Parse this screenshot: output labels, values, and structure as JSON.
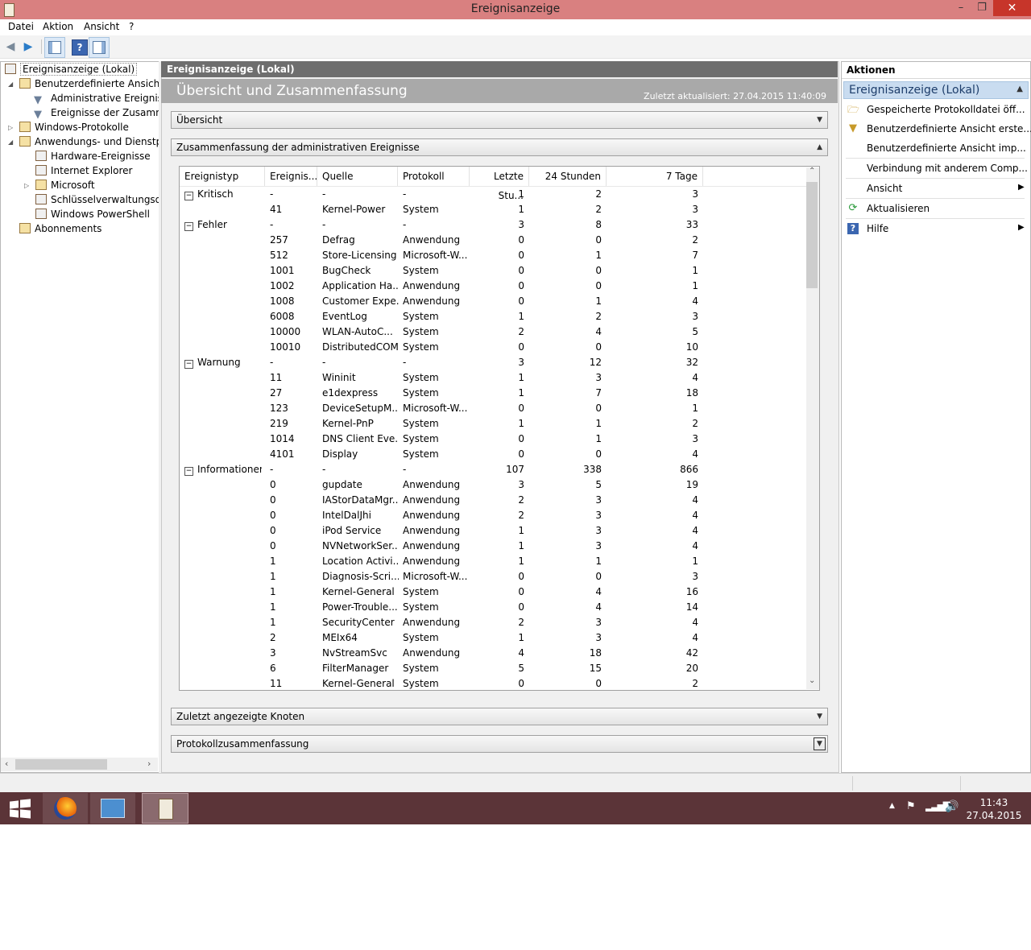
{
  "window": {
    "title": "Ereignisanzeige"
  },
  "menu": [
    "Datei",
    "Aktion",
    "Ansicht",
    "?"
  ],
  "tree": {
    "items": [
      {
        "label": "Ereignisanzeige (Lokal)"
      },
      {
        "label": "Benutzerdefinierte Ansichten"
      },
      {
        "label": "Administrative Ereignisse"
      },
      {
        "label": "Ereignisse der Zusammenfassung"
      },
      {
        "label": "Windows-Protokolle"
      },
      {
        "label": "Anwendungs- und Dienstprotokolle"
      },
      {
        "label": "Hardware-Ereignisse"
      },
      {
        "label": "Internet Explorer"
      },
      {
        "label": "Microsoft"
      },
      {
        "label": "Schlüsselverwaltungsdienst"
      },
      {
        "label": "Windows PowerShell"
      },
      {
        "label": "Abonnements"
      }
    ]
  },
  "center": {
    "header": "Ereignisanzeige (Lokal)",
    "title": "Übersicht und Zusammenfassung",
    "updated": "Zuletzt aktualisiert: 27.04.2015 11:40:09",
    "sections": {
      "overview": "Übersicht",
      "summary": "Zusammenfassung der administrativen Ereignisse",
      "recent": "Zuletzt angezeigte Knoten",
      "log": "Protokollzusammenfassung"
    },
    "columns": [
      "Ereignistyp",
      "Ereignis...",
      "Quelle",
      "Protokoll",
      "Letzte Stu...",
      "24 Stunden",
      "7 Tage"
    ],
    "rows": [
      [
        "Kritisch",
        "-",
        "-",
        "-",
        "1",
        "2",
        "3"
      ],
      [
        "",
        "41",
        "Kernel-Power",
        "System",
        "1",
        "2",
        "3"
      ],
      [
        "Fehler",
        "-",
        "-",
        "-",
        "3",
        "8",
        "33"
      ],
      [
        "",
        "257",
        "Defrag",
        "Anwendung",
        "0",
        "0",
        "2"
      ],
      [
        "",
        "512",
        "Store-Licensing",
        "Microsoft-W...",
        "0",
        "1",
        "7"
      ],
      [
        "",
        "1001",
        "BugCheck",
        "System",
        "0",
        "0",
        "1"
      ],
      [
        "",
        "1002",
        "Application Ha...",
        "Anwendung",
        "0",
        "0",
        "1"
      ],
      [
        "",
        "1008",
        "Customer Expe...",
        "Anwendung",
        "0",
        "1",
        "4"
      ],
      [
        "",
        "6008",
        "EventLog",
        "System",
        "1",
        "2",
        "3"
      ],
      [
        "",
        "10000",
        "WLAN-AutoC...",
        "System",
        "2",
        "4",
        "5"
      ],
      [
        "",
        "10010",
        "DistributedCOM",
        "System",
        "0",
        "0",
        "10"
      ],
      [
        "Warnung",
        "-",
        "-",
        "-",
        "3",
        "12",
        "32"
      ],
      [
        "",
        "11",
        "Wininit",
        "System",
        "1",
        "3",
        "4"
      ],
      [
        "",
        "27",
        "e1dexpress",
        "System",
        "1",
        "7",
        "18"
      ],
      [
        "",
        "123",
        "DeviceSetupM...",
        "Microsoft-W...",
        "0",
        "0",
        "1"
      ],
      [
        "",
        "219",
        "Kernel-PnP",
        "System",
        "1",
        "1",
        "2"
      ],
      [
        "",
        "1014",
        "DNS Client Eve...",
        "System",
        "0",
        "1",
        "3"
      ],
      [
        "",
        "4101",
        "Display",
        "System",
        "0",
        "0",
        "4"
      ],
      [
        "Informationen",
        "-",
        "-",
        "-",
        "107",
        "338",
        "866"
      ],
      [
        "",
        "0",
        "gupdate",
        "Anwendung",
        "3",
        "5",
        "19"
      ],
      [
        "",
        "0",
        "IAStorDataMgr...",
        "Anwendung",
        "2",
        "3",
        "4"
      ],
      [
        "",
        "0",
        "IntelDalJhi",
        "Anwendung",
        "2",
        "3",
        "4"
      ],
      [
        "",
        "0",
        "iPod Service",
        "Anwendung",
        "1",
        "3",
        "4"
      ],
      [
        "",
        "0",
        "NVNetworkSer...",
        "Anwendung",
        "1",
        "3",
        "4"
      ],
      [
        "",
        "1",
        "Location Activi...",
        "Anwendung",
        "1",
        "1",
        "1"
      ],
      [
        "",
        "1",
        "Diagnosis-Scri...",
        "Microsoft-W...",
        "0",
        "0",
        "3"
      ],
      [
        "",
        "1",
        "Kernel-General",
        "System",
        "0",
        "4",
        "16"
      ],
      [
        "",
        "1",
        "Power-Trouble...",
        "System",
        "0",
        "4",
        "14"
      ],
      [
        "",
        "1",
        "SecurityCenter",
        "Anwendung",
        "2",
        "3",
        "4"
      ],
      [
        "",
        "2",
        "MEIx64",
        "System",
        "1",
        "3",
        "4"
      ],
      [
        "",
        "3",
        "NvStreamSvc",
        "Anwendung",
        "4",
        "18",
        "42"
      ],
      [
        "",
        "6",
        "FilterManager",
        "System",
        "5",
        "15",
        "20"
      ],
      [
        "",
        "11",
        "Kernel-General",
        "System",
        "0",
        "0",
        "2"
      ]
    ]
  },
  "actions": {
    "header": "Aktionen",
    "group": "Ereignisanzeige (Lokal)",
    "items": [
      {
        "label": "Gespeicherte Protokolldatei öff...",
        "icon": "folder-open-icon"
      },
      {
        "label": "Benutzerdefinierte Ansicht erste...",
        "icon": "filter-icon"
      },
      {
        "label": "Benutzerdefinierte Ansicht imp...",
        "icon": ""
      },
      {
        "label": "Verbindung mit anderem Comp...",
        "icon": ""
      },
      {
        "label": "Ansicht",
        "icon": ""
      },
      {
        "label": "Aktualisieren",
        "icon": "refresh-icon"
      },
      {
        "label": "Hilfe",
        "icon": "help-icon"
      }
    ]
  },
  "taskbar": {
    "time": "11:43",
    "date": "27.04.2015"
  },
  "colors": {
    "titlebar": "#d98080",
    "close": "#c7352a",
    "taskbar": "#5b3438",
    "accent": "#2a7cc8",
    "selection_header": "#c9dcf0"
  }
}
